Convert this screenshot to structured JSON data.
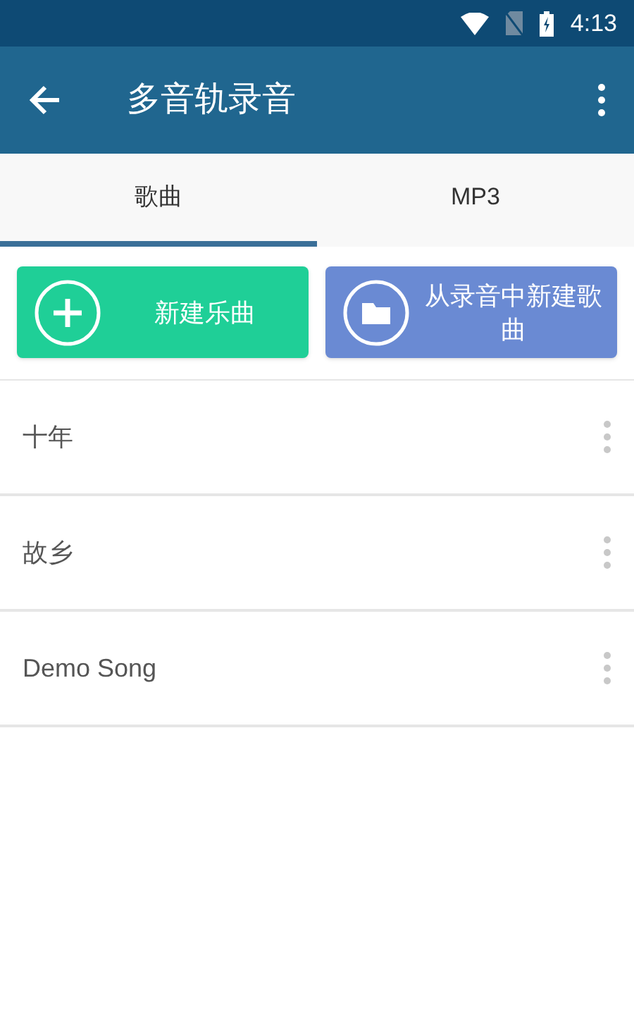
{
  "status_bar": {
    "time": "4:13"
  },
  "app_bar": {
    "title": "多音轨录音"
  },
  "tabs": [
    {
      "label": "歌曲",
      "selected": true
    },
    {
      "label": "MP3",
      "selected": false
    }
  ],
  "actions": [
    {
      "kind": "new",
      "label": "新建乐曲",
      "color": "#1fcf97"
    },
    {
      "kind": "import",
      "label": "从录音中新建歌曲",
      "color": "#6a8ad3"
    }
  ],
  "songs": [
    {
      "title": "十年"
    },
    {
      "title": "故乡"
    },
    {
      "title": "Demo Song"
    }
  ]
}
